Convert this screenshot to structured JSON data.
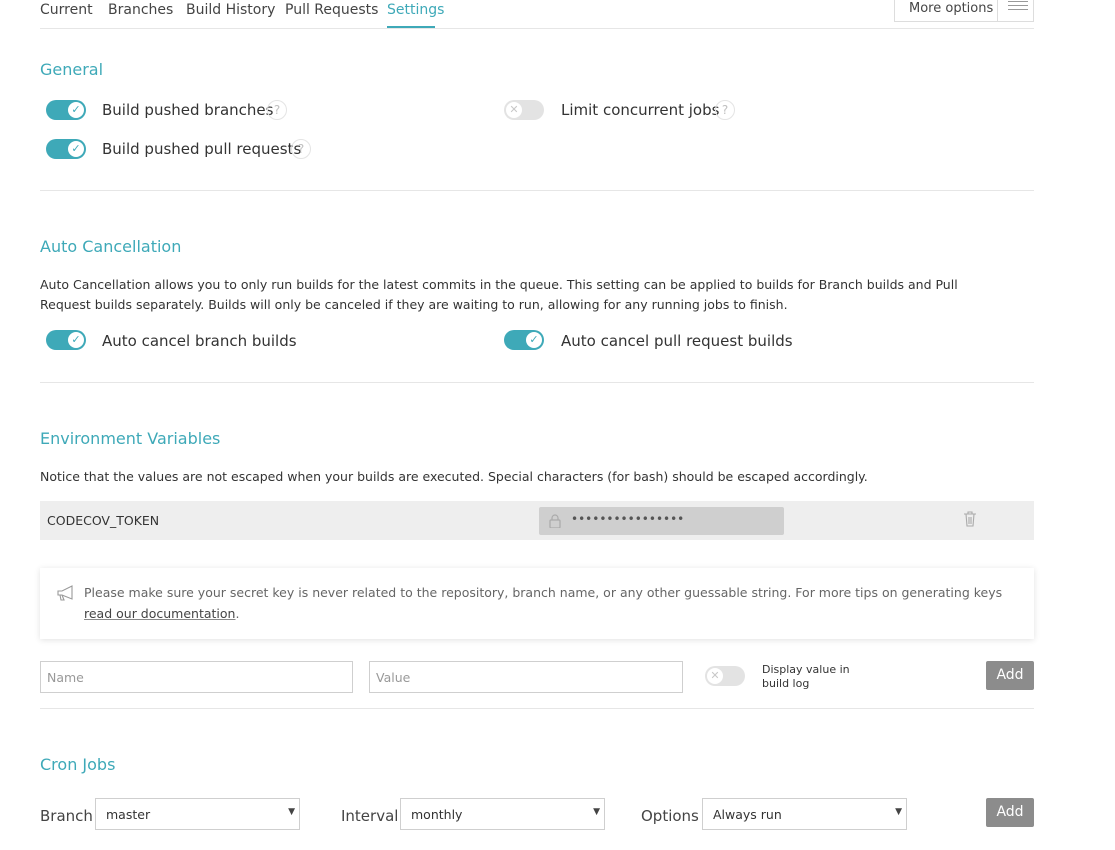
{
  "tabs": [
    {
      "label": "Current"
    },
    {
      "label": "Branches"
    },
    {
      "label": "Build History"
    },
    {
      "label": "Pull Requests"
    },
    {
      "label": "Settings"
    }
  ],
  "more_options": {
    "label": "More options"
  },
  "general": {
    "title": "General",
    "settings": [
      {
        "label": "Build pushed branches",
        "on": true,
        "help": "?"
      },
      {
        "label": "Build pushed pull requests",
        "on": true,
        "help": "?"
      },
      {
        "label": "Limit concurrent jobs",
        "on": false,
        "help": "?"
      }
    ]
  },
  "auto_cancel": {
    "title": "Auto Cancellation",
    "description": "Auto Cancellation allows you to only run builds for the latest commits in the queue. This setting can be applied to builds for Branch builds and Pull Request builds separately. Builds will only be canceled if they are waiting to run, allowing for any running jobs to finish.",
    "settings": [
      {
        "label": "Auto cancel branch builds",
        "on": true
      },
      {
        "label": "Auto cancel pull request builds",
        "on": true
      }
    ]
  },
  "env": {
    "title": "Environment Variables",
    "notice": "Notice that the values are not escaped when your builds are executed. Special characters (for bash) should be escaped accordingly.",
    "variables": [
      {
        "name": "CODECOV_TOKEN",
        "value": "••••••••••••••••"
      }
    ],
    "tip_text": "Please make sure your secret key is never related to the repository, branch name, or any other guessable string. For more tips on generating keys ",
    "tip_link": "read our documentation",
    "tip_end": ".",
    "name_placeholder": "Name",
    "value_placeholder": "Value",
    "display_label": "Display value in build log",
    "add_label": "Add"
  },
  "cron": {
    "title": "Cron Jobs",
    "branch_label": "Branch",
    "branch_value": "master",
    "interval_label": "Interval",
    "interval_value": "monthly",
    "options_label": "Options",
    "options_value": "Always run",
    "add_label": "Add"
  },
  "colors": {
    "accent": "#3ea9b8",
    "toggle_off": "#e3e3e3",
    "button": "#8c8c8c"
  }
}
